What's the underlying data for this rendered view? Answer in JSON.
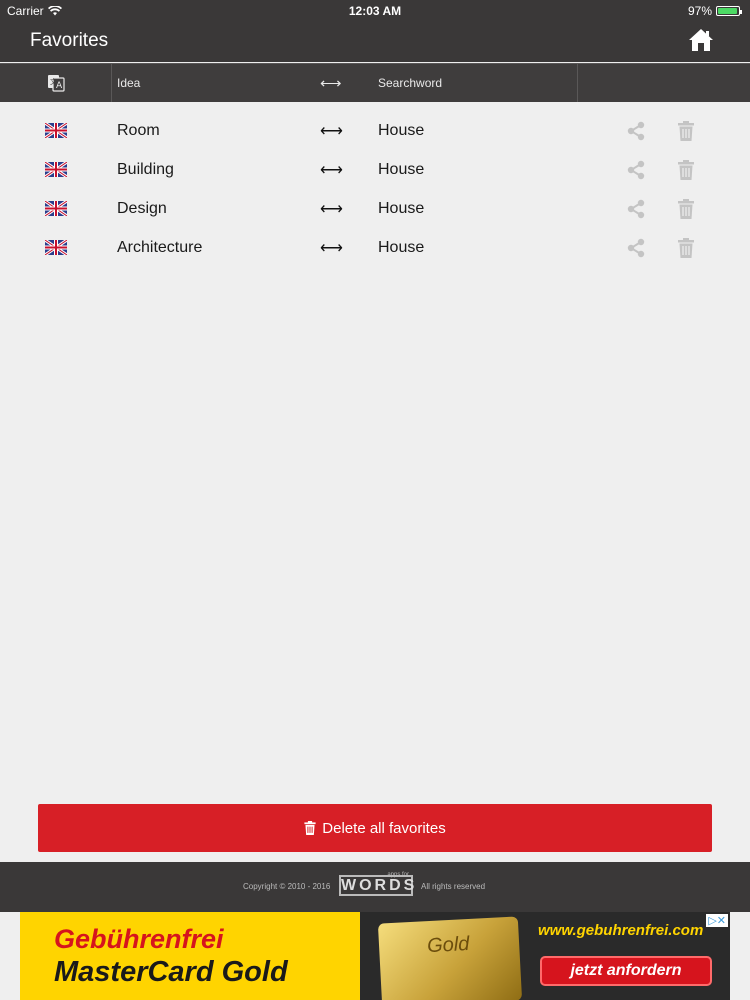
{
  "status_bar": {
    "carrier": "Carrier",
    "time": "12:03 AM",
    "battery": "97%",
    "battery_level": 0.97
  },
  "nav": {
    "title": "Favorites",
    "home_icon": "home-icon"
  },
  "columns": {
    "language_icon": "translate-icon",
    "idea": "Idea",
    "arrow": "⟷",
    "searchword": "Searchword"
  },
  "favorites": [
    {
      "flag": "uk-flag-icon",
      "idea": "Room",
      "arrow": "⟷",
      "searchword": "House"
    },
    {
      "flag": "uk-flag-icon",
      "idea": "Building",
      "arrow": "⟷",
      "searchword": "House"
    },
    {
      "flag": "uk-flag-icon",
      "idea": "Design",
      "arrow": "⟷",
      "searchword": "House"
    },
    {
      "flag": "uk-flag-icon",
      "idea": "Architecture",
      "arrow": "⟷",
      "searchword": "House"
    }
  ],
  "delete_all": {
    "label": "Delete all favorites",
    "icon": "trash-icon"
  },
  "footer": {
    "copyright": "Copyright © 2010 - 2016",
    "logo": "WORDS",
    "logo_sup": "apps.for",
    "rights": "All rights reserved"
  },
  "ad": {
    "line1": "Gebührenfrei",
    "line2": "MasterCard Gold",
    "card_text": "Gold",
    "url": "www.gebuhrenfrei.com",
    "cta": "jetzt anfordern",
    "adchoices": "▷✕",
    "colors": {
      "background": "#ffd400",
      "accent": "#d6141d"
    }
  }
}
